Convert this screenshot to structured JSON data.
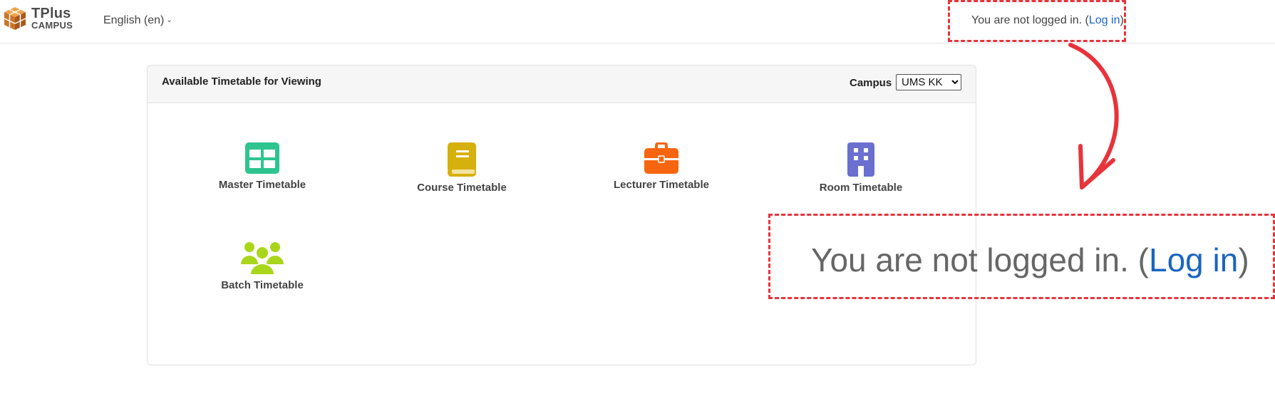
{
  "navbar": {
    "logo_title": "TPlus",
    "logo_subtitle": "CAMPUS",
    "language": "English (en)",
    "login_text": "You are not logged in. (",
    "login_link": "Log in",
    "login_close": ")"
  },
  "card": {
    "title": "Available Timetable for Viewing",
    "campus_label": "Campus",
    "campus_selected": "UMS KK",
    "tiles": [
      {
        "label": "Master Timetable",
        "icon": "table-icon",
        "color": "#2ec48f"
      },
      {
        "label": "Course Timetable",
        "icon": "book-icon",
        "color": "#d6b00c"
      },
      {
        "label": "Lecturer Timetable",
        "icon": "briefcase-icon",
        "color": "#f7650f"
      },
      {
        "label": "Room Timetable",
        "icon": "building-icon",
        "color": "#6a6fd0"
      },
      {
        "label": "Batch Timetable",
        "icon": "users-icon",
        "color": "#a9d61a"
      }
    ]
  },
  "annotation": {
    "zoom_text": "You are not logged in. (",
    "zoom_link": "Log in",
    "zoom_close": ")",
    "color": "#e8333b"
  }
}
